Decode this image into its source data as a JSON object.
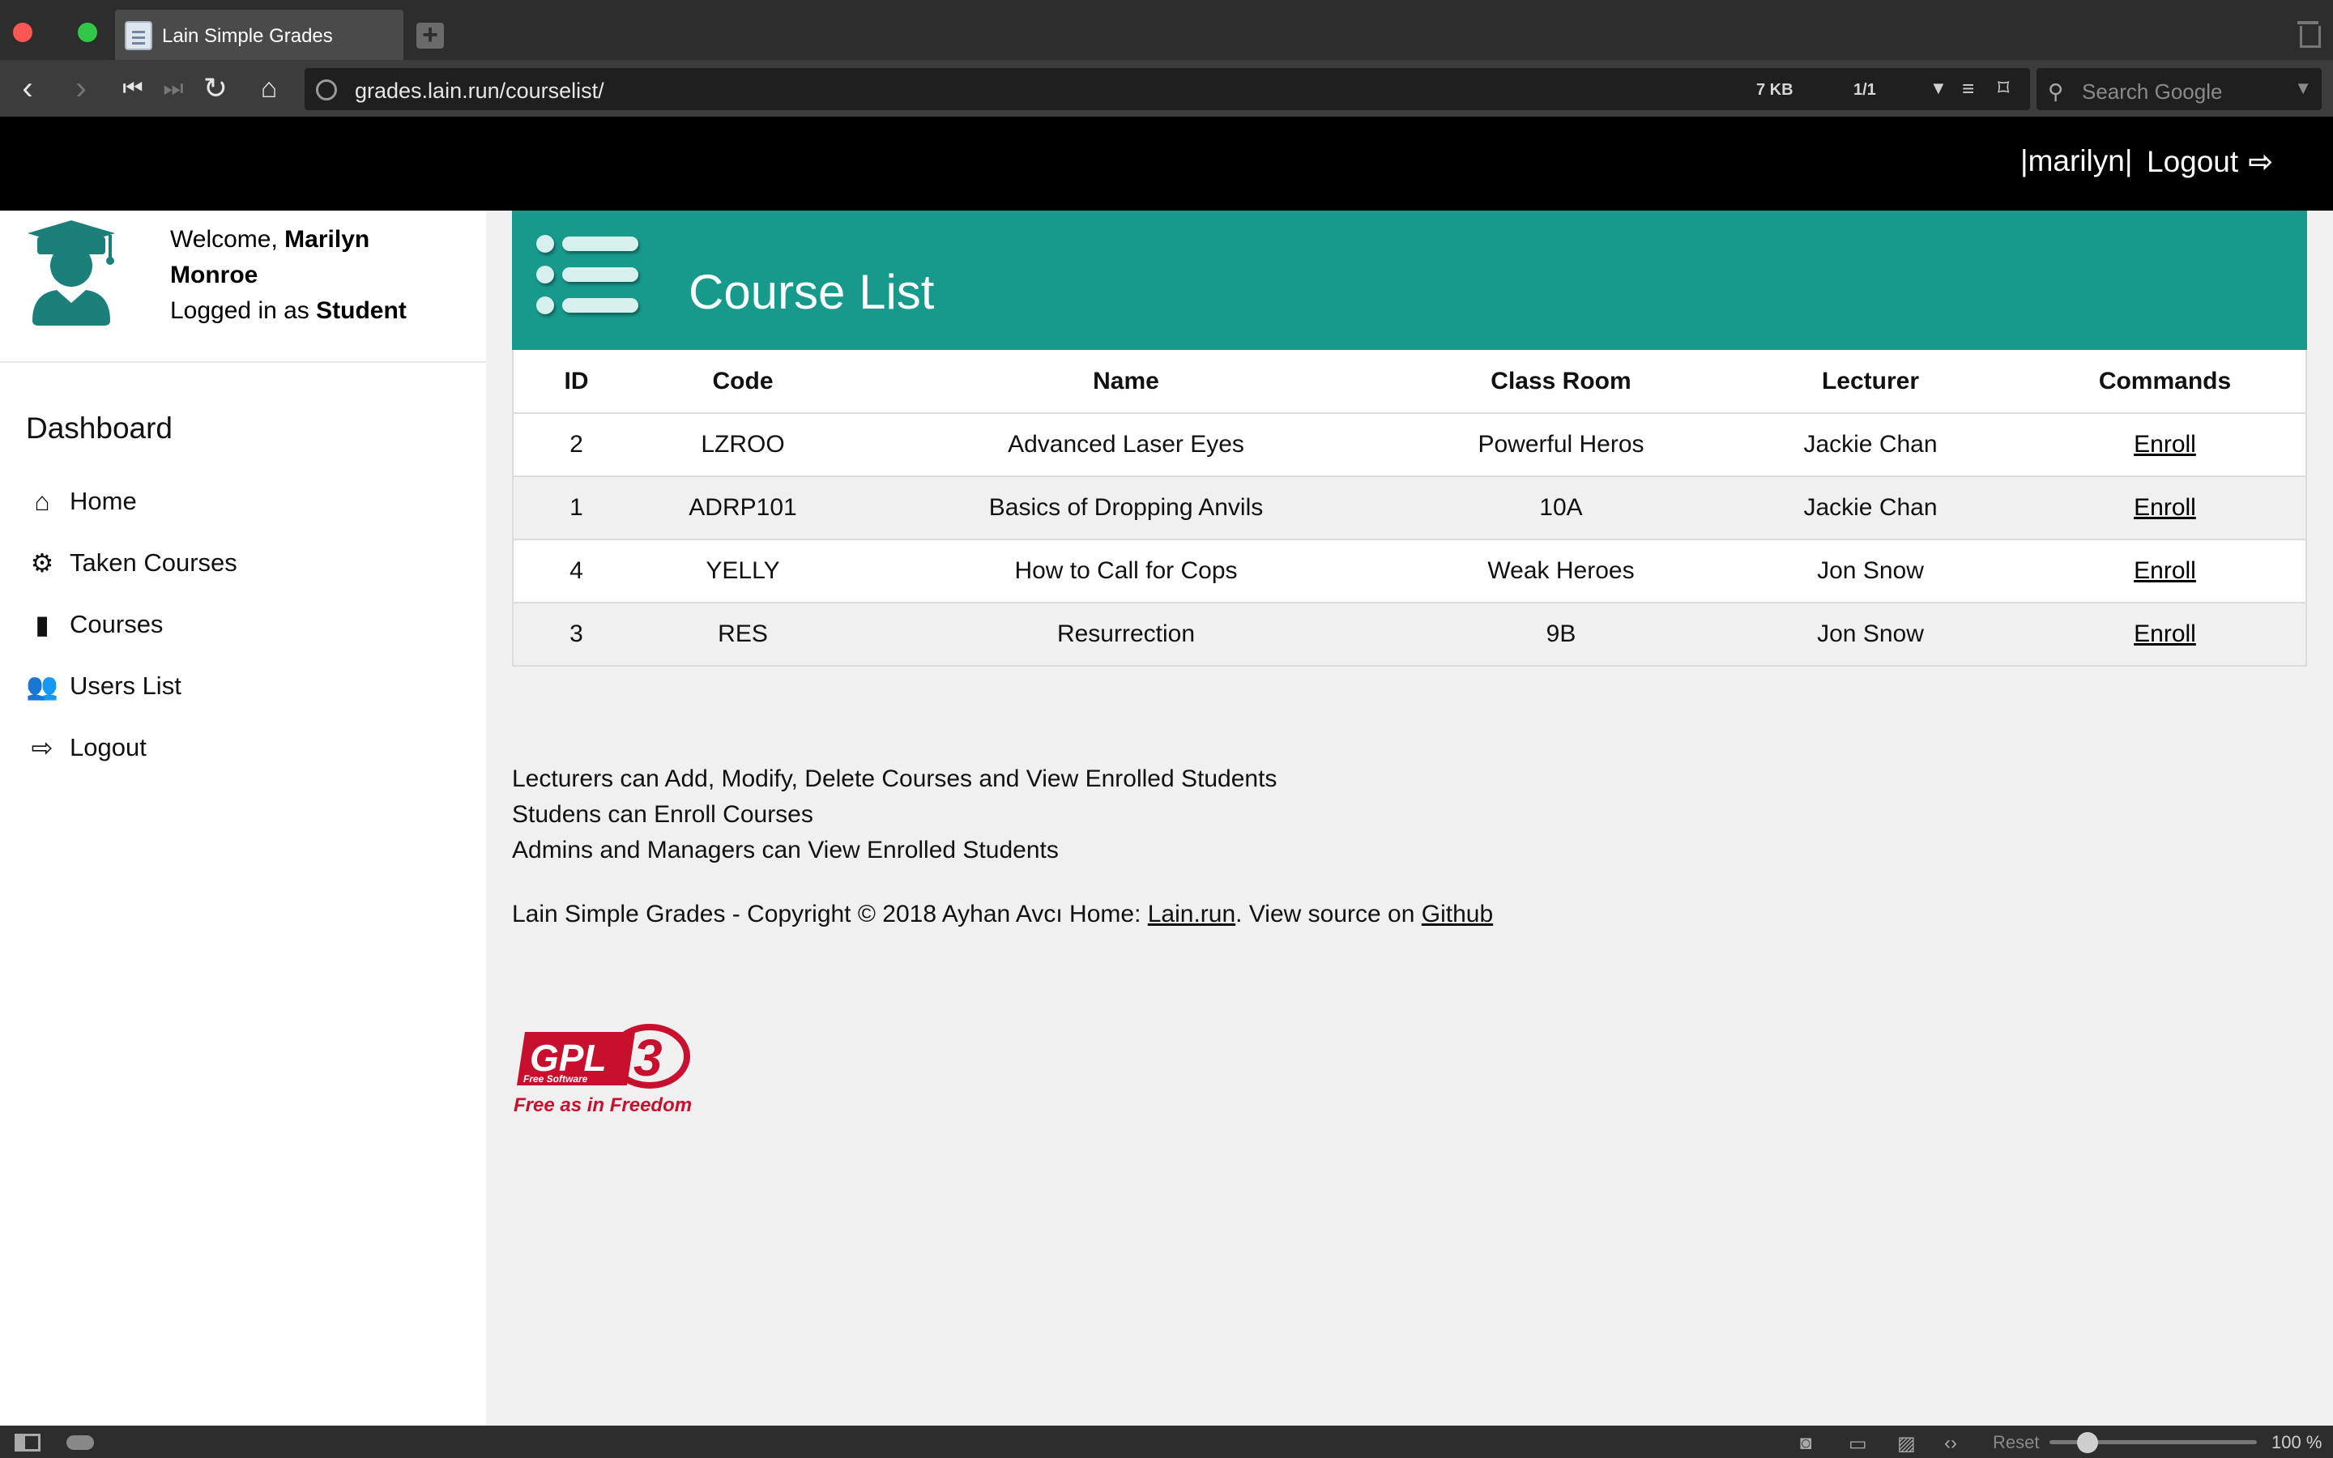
{
  "browser": {
    "tab_title": "Lain Simple Grades",
    "new_tab_symbol": "+",
    "url": "grades.lain.run/courselist/",
    "page_size": "7 KB",
    "page_count": "1/1",
    "search_placeholder": "Search Google",
    "nav_icons": [
      "back-icon",
      "forward-icon",
      "rewind-icon",
      "fast-forward-icon",
      "reload-icon",
      "home-icon"
    ]
  },
  "header": {
    "username_display": "|marilyn|",
    "logout_label": "Logout"
  },
  "sidebar": {
    "welcome_prefix": "Welcome,",
    "user_full_name": "Marilyn Monroe",
    "logged_in_prefix": "Logged in as",
    "role": "Student",
    "section_title": "Dashboard",
    "items": [
      {
        "label": "Home",
        "icon": "home-icon"
      },
      {
        "label": "Taken Courses",
        "icon": "gears-icon"
      },
      {
        "label": "Courses",
        "icon": "book-icon"
      },
      {
        "label": "Users List",
        "icon": "users-icon"
      },
      {
        "label": "Logout",
        "icon": "sign-out-icon"
      }
    ]
  },
  "main": {
    "title": "Course List",
    "table": {
      "columns": [
        "ID",
        "Code",
        "Name",
        "Class Room",
        "Lecturer",
        "Commands"
      ],
      "rows": [
        {
          "id": "2",
          "code": "LZROO",
          "name": "Advanced Laser Eyes",
          "classroom": "Powerful Heros",
          "lecturer": "Jackie Chan",
          "command": "Enroll"
        },
        {
          "id": "1",
          "code": "ADRP101",
          "name": "Basics of Dropping Anvils",
          "classroom": "10A",
          "lecturer": "Jackie Chan",
          "command": "Enroll"
        },
        {
          "id": "4",
          "code": "YELLY",
          "name": "How to Call for Cops",
          "classroom": "Weak Heroes",
          "lecturer": "Jon Snow",
          "command": "Enroll"
        },
        {
          "id": "3",
          "code": "RES",
          "name": "Resurrection",
          "classroom": "9B",
          "lecturer": "Jon Snow",
          "command": "Enroll"
        }
      ]
    },
    "notes": [
      "Lecturers can Add, Modify, Delete Courses and View Enrolled Students",
      "Studens can Enroll Courses",
      "Admins and Managers can View Enrolled Students"
    ]
  },
  "footer": {
    "copyright_text": "Lain Simple Grades - Copyright © 2018 Ayhan Avcı Home: ",
    "home_link": "Lain.run",
    "source_text": ". View source on ",
    "source_link": "Github",
    "gpl_logo_text": "GPL",
    "gpl_subtext": "Free Software",
    "gpl_version": "3",
    "gpl_tagline": "Free as in Freedom"
  },
  "statusbar": {
    "reset_label": "Reset",
    "zoom_label": "100 %",
    "zoom_level_percent": 100
  },
  "colors": {
    "accent": "#17998c",
    "header_bg": "#000000",
    "gpl_red": "#c8102e"
  }
}
